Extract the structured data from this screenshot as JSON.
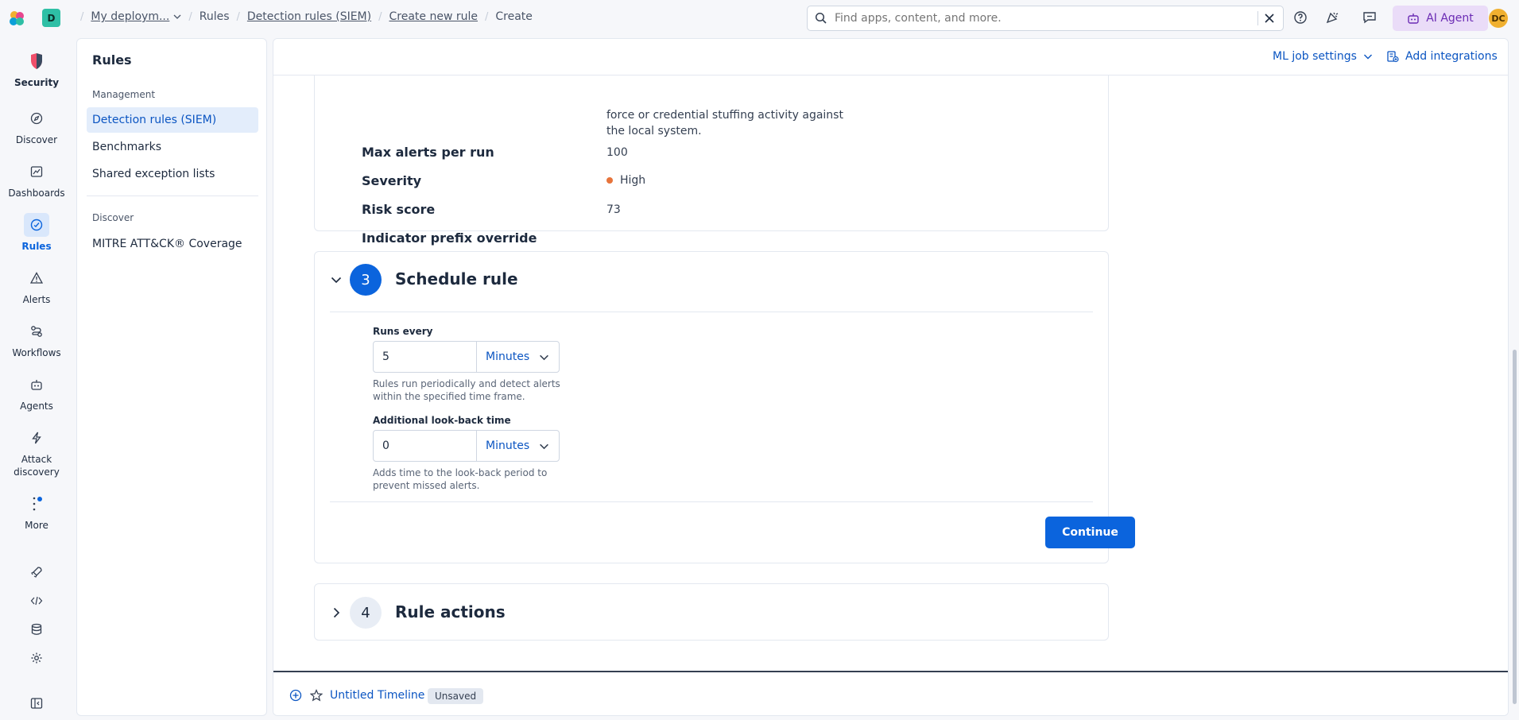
{
  "topbar": {
    "space_initial": "D",
    "breadcrumbs": [
      "My deploym...",
      "Rules",
      "Detection rules (SIEM)",
      "Create new rule",
      "Create"
    ],
    "search_placeholder": "Find apps, content, and more.",
    "ai_agent_label": "AI Agent",
    "avatar_initials": "DC"
  },
  "leftnav": {
    "items": [
      {
        "label": "Security",
        "icon": "security-logo-icon"
      },
      {
        "label": "Discover",
        "icon": "compass-icon"
      },
      {
        "label": "Dashboards",
        "icon": "dashboard-icon"
      },
      {
        "label": "Rules",
        "icon": "rules-icon"
      },
      {
        "label": "Alerts",
        "icon": "warning-icon"
      },
      {
        "label": "Workflows",
        "icon": "workflow-icon"
      },
      {
        "label": "Agents",
        "icon": "robot-icon"
      },
      {
        "label": "Attack discovery",
        "icon": "bolt-icon"
      },
      {
        "label": "More",
        "icon": "more-icon"
      }
    ]
  },
  "sidepanel": {
    "title": "Rules",
    "group_management": "Management",
    "items_management": [
      "Detection rules (SIEM)",
      "Benchmarks",
      "Shared exception lists"
    ],
    "group_discover": "Discover",
    "items_discover": [
      "MITRE ATT&CK® Coverage"
    ]
  },
  "header": {
    "ml_job_settings": "ML job settings",
    "add_integrations": "Add integrations"
  },
  "about": {
    "description_tail_1": "force or credential stuffing activity against",
    "description_tail_2": "the local system.",
    "max_alerts_label": "Max alerts per run",
    "max_alerts_value": "100",
    "severity_label": "Severity",
    "severity_value": "High",
    "risk_score_label": "Risk score",
    "risk_score_value": "73",
    "indicator_label": "Indicator prefix override"
  },
  "schedule": {
    "step_number": "3",
    "title": "Schedule rule",
    "runs_every_label": "Runs every",
    "runs_every_value": "5",
    "runs_every_unit": "Minutes",
    "runs_every_help": "Rules run periodically and detect alerts within the specified time frame.",
    "lookback_label": "Additional look-back time",
    "lookback_value": "0",
    "lookback_unit": "Minutes",
    "lookback_help": "Adds time to the look-back period to prevent missed alerts.",
    "continue_label": "Continue"
  },
  "actions": {
    "step_number": "4",
    "title": "Rule actions"
  },
  "timeline": {
    "title": "Untitled Timeline",
    "badge": "Unsaved"
  }
}
